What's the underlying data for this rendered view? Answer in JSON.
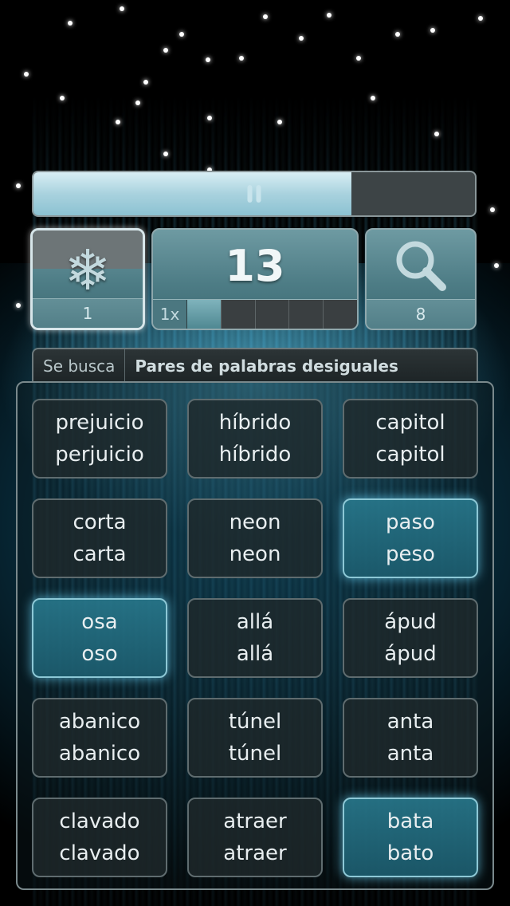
{
  "game": {
    "progress_fraction": 0.72,
    "paused_icon": "pause-icon"
  },
  "powerups": {
    "freeze": {
      "icon": "snowflake-icon",
      "count": "1"
    },
    "score": {
      "value": "13",
      "multiplier": "1x",
      "meter_filled": 1,
      "meter_segments": 5
    },
    "hint": {
      "icon": "magnifier-icon",
      "count": "8"
    }
  },
  "task": {
    "label": "Se busca",
    "value": "Pares de palabras desiguales"
  },
  "cards": [
    {
      "top": "prejuicio",
      "bottom": "perjuicio",
      "selected": false
    },
    {
      "top": "híbrido",
      "bottom": "híbrido",
      "selected": false
    },
    {
      "top": "capitol",
      "bottom": "capitol",
      "selected": false
    },
    {
      "top": "corta",
      "bottom": "carta",
      "selected": false
    },
    {
      "top": "neon",
      "bottom": "neon",
      "selected": false
    },
    {
      "top": "paso",
      "bottom": "peso",
      "selected": true
    },
    {
      "top": "osa",
      "bottom": "oso",
      "selected": true
    },
    {
      "top": "allá",
      "bottom": "allá",
      "selected": false
    },
    {
      "top": "ápud",
      "bottom": "ápud",
      "selected": false
    },
    {
      "top": "abanico",
      "bottom": "abanico",
      "selected": false
    },
    {
      "top": "túnel",
      "bottom": "túnel",
      "selected": false
    },
    {
      "top": "anta",
      "bottom": "anta",
      "selected": false
    },
    {
      "top": "clavado",
      "bottom": "clavado",
      "selected": false
    },
    {
      "top": "atraer",
      "bottom": "atraer",
      "selected": false
    },
    {
      "top": "bata",
      "bottom": "bato",
      "selected": true
    }
  ]
}
